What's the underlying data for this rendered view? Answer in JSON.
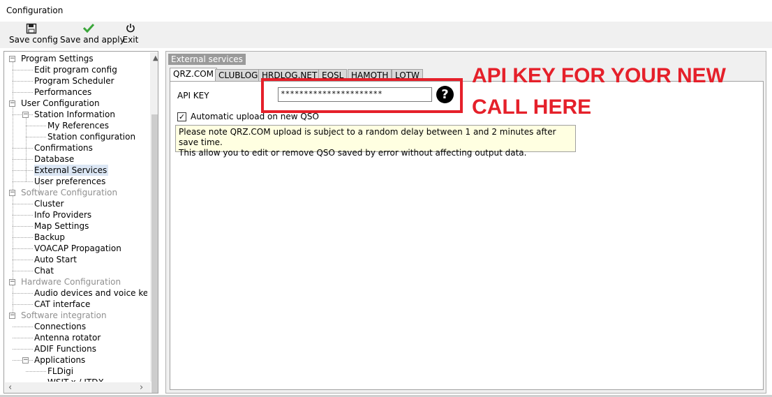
{
  "window": {
    "title": "Configuration"
  },
  "toolbar": {
    "save_config": {
      "label": "Save config",
      "icon": "floppy-disk-icon"
    },
    "save_apply": {
      "label": "Save and apply",
      "icon": "checkmark-icon"
    },
    "exit": {
      "label": "Exit",
      "icon": "power-icon"
    }
  },
  "tree": {
    "items": [
      {
        "label": "Program Settings",
        "level": 0,
        "toggle": "⊟",
        "style": "normal"
      },
      {
        "label": "Edit program config",
        "level": 1,
        "style": "normal"
      },
      {
        "label": "Program Scheduler",
        "level": 1,
        "style": "normal"
      },
      {
        "label": "Performances",
        "level": 1,
        "style": "normal"
      },
      {
        "label": "User Configuration",
        "level": 0,
        "toggle": "⊟",
        "style": "normal"
      },
      {
        "label": "Station Information",
        "level": 1,
        "toggle": "⊟",
        "style": "normal"
      },
      {
        "label": "My References",
        "level": 2,
        "style": "normal"
      },
      {
        "label": "Station configuration",
        "level": 2,
        "style": "normal"
      },
      {
        "label": "Confirmations",
        "level": 1,
        "style": "normal"
      },
      {
        "label": "Database",
        "level": 1,
        "style": "normal"
      },
      {
        "label": "External Services",
        "level": 1,
        "style": "selected"
      },
      {
        "label": "User preferences",
        "level": 1,
        "style": "normal"
      },
      {
        "label": "Software Configuration",
        "level": 0,
        "toggle": "⊟",
        "style": "gray"
      },
      {
        "label": "Cluster",
        "level": 1,
        "style": "normal"
      },
      {
        "label": "Info Providers",
        "level": 1,
        "style": "normal"
      },
      {
        "label": "Map Settings",
        "level": 1,
        "style": "normal"
      },
      {
        "label": "Backup",
        "level": 1,
        "style": "normal"
      },
      {
        "label": "VOACAP Propagation",
        "level": 1,
        "style": "normal"
      },
      {
        "label": "Auto Start",
        "level": 1,
        "style": "normal"
      },
      {
        "label": "Chat",
        "level": 1,
        "style": "normal"
      },
      {
        "label": "Hardware Configuration",
        "level": 0,
        "toggle": "⊟",
        "style": "gray"
      },
      {
        "label": "Audio devices and voice keyer",
        "level": 1,
        "style": "normal"
      },
      {
        "label": "CAT interface",
        "level": 1,
        "style": "normal"
      },
      {
        "label": "Software integration",
        "level": 0,
        "toggle": "⊟",
        "style": "gray"
      },
      {
        "label": "Connections",
        "level": 1,
        "style": "normal"
      },
      {
        "label": "Antenna rotator",
        "level": 1,
        "style": "normal"
      },
      {
        "label": "ADIF Functions",
        "level": 1,
        "style": "normal"
      },
      {
        "label": "Applications",
        "level": 1,
        "toggle": "⊟",
        "style": "normal"
      },
      {
        "label": "FLDigi",
        "level": 2,
        "style": "normal"
      },
      {
        "label": "WSJT-x / JTDX",
        "level": 2,
        "style": "normal"
      }
    ]
  },
  "panel": {
    "group_label": "External services",
    "tabs": [
      "QRZ.COM",
      "CLUBLOG",
      "HRDLOG.NET",
      "EQSL",
      "HAMQTH",
      "LOTW"
    ],
    "active_tab": "QRZ.COM",
    "api_key_label": "API KEY",
    "api_key_value": "**********************",
    "help_icon": "question-circle-icon",
    "auto_upload_label": "Automatic upload on new QSO",
    "auto_upload_checked": true,
    "note_line1": "Please note QRZ.COM upload is subject to a random delay between 1 and 2 minutes after save time.",
    "note_line2": "This allow you to edit or remove QSO saved by error without affecting output data."
  },
  "annotation": {
    "line1": "API KEY FOR YOUR NEW",
    "line2": "CALL HERE",
    "color": "#e5202a"
  }
}
